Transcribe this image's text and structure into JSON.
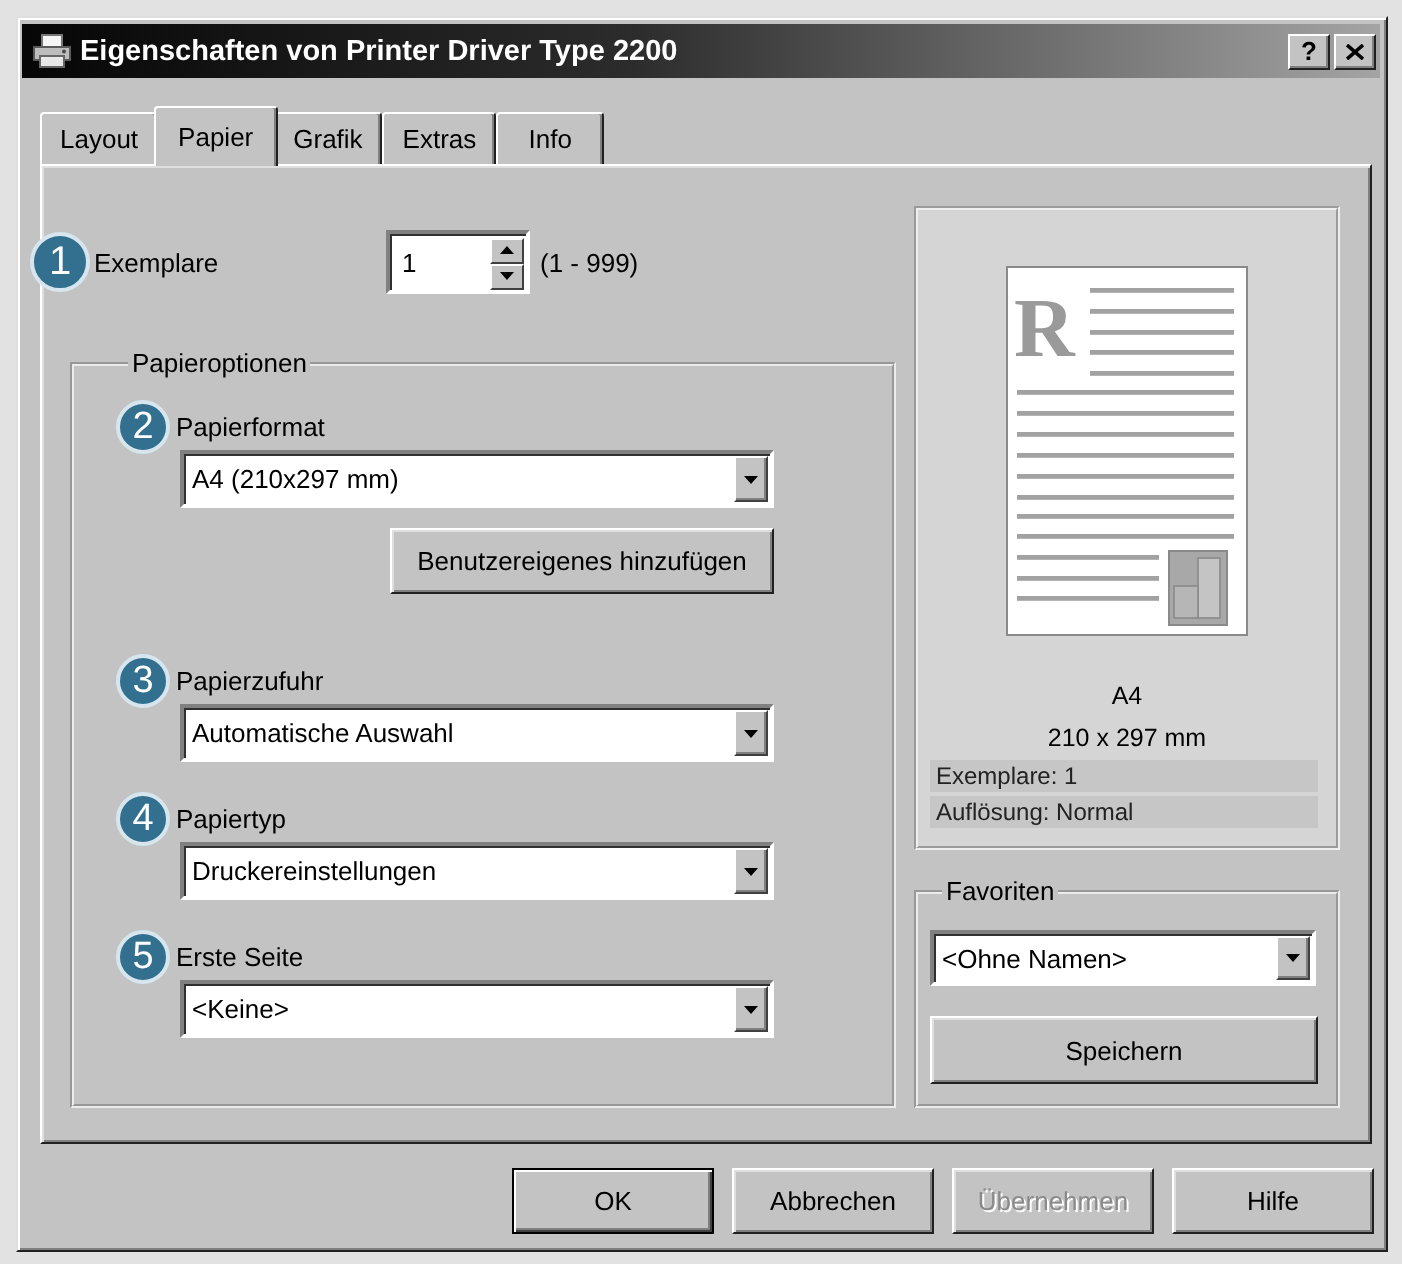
{
  "window": {
    "title": "Eigenschaften von Printer Driver Type 2200",
    "help": "?"
  },
  "tabs": [
    {
      "label": "Layout",
      "selected": false
    },
    {
      "label": "Papier",
      "selected": true
    },
    {
      "label": "Grafik",
      "selected": false
    },
    {
      "label": "Extras",
      "selected": false
    },
    {
      "label": "Info",
      "selected": false
    }
  ],
  "copies": {
    "badge": "1",
    "label": "Exemplare",
    "value": "1",
    "range": "(1 - 999)"
  },
  "paper_options": {
    "legend": "Papieroptionen",
    "fields": [
      {
        "badge": "2",
        "label": "Papierformat",
        "value": "A4 (210x297 mm)",
        "button": "Benutzereigenes hinzufügen"
      },
      {
        "badge": "3",
        "label": "Papierzufuhr",
        "value": "Automatische Auswahl"
      },
      {
        "badge": "4",
        "label": "Papiertyp",
        "value": "Druckereinstellungen"
      },
      {
        "badge": "5",
        "label": "Erste Seite",
        "value": "<Keine>"
      }
    ]
  },
  "preview": {
    "page_letter": "R",
    "paper_size": "A4",
    "dimensions": "210 x 297 mm",
    "summary": [
      "Exemplare: 1",
      "Auflösung: Normal"
    ]
  },
  "favorites": {
    "legend": "Favoriten",
    "value": "<Ohne Namen>",
    "button": "Speichern"
  },
  "buttons": [
    {
      "label": "OK",
      "default": true,
      "disabled": false
    },
    {
      "label": "Abbrechen",
      "default": false,
      "disabled": false
    },
    {
      "label": "Übernehmen",
      "default": false,
      "disabled": true
    },
    {
      "label": "Hilfe",
      "default": false,
      "disabled": false
    }
  ]
}
